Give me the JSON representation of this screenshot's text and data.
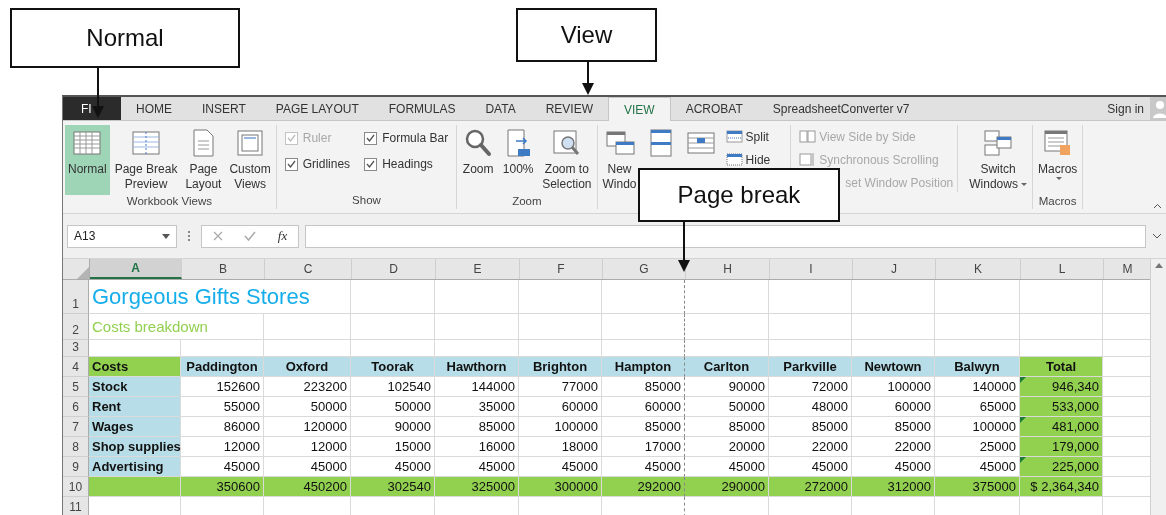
{
  "callouts": [
    {
      "text": "Normal"
    },
    {
      "text": "View"
    },
    {
      "text": "Page break"
    }
  ],
  "tabs": [
    {
      "label": "FI",
      "kind": "file",
      "selected": false
    },
    {
      "label": "HOME",
      "kind": "tab",
      "selected": false
    },
    {
      "label": "INSERT",
      "kind": "tab",
      "selected": false
    },
    {
      "label": "PAGE LAYOUT",
      "kind": "tab",
      "selected": false
    },
    {
      "label": "FORMULAS",
      "kind": "tab",
      "selected": false
    },
    {
      "label": "DATA",
      "kind": "tab",
      "selected": false
    },
    {
      "label": "REVIEW",
      "kind": "tab",
      "selected": false
    },
    {
      "label": "VIEW",
      "kind": "tab",
      "selected": true
    },
    {
      "label": "ACROBAT",
      "kind": "tab",
      "selected": false
    },
    {
      "label": "SpreadsheetConverter v7",
      "kind": "tab",
      "selected": false
    }
  ],
  "account": {
    "label": "Sign in"
  },
  "ribbon": {
    "groups": [
      {
        "label": "Workbook Views",
        "items": [
          {
            "kind": "large",
            "lines": [
              "Normal"
            ],
            "selected": true
          },
          {
            "kind": "large",
            "lines": [
              "Page Break",
              "Preview"
            ],
            "selected": false
          },
          {
            "kind": "large",
            "lines": [
              "Page",
              "Layout"
            ],
            "selected": false
          },
          {
            "kind": "large",
            "lines": [
              "Custom",
              "Views"
            ],
            "selected": false
          }
        ]
      },
      {
        "label": "Show",
        "items": [
          {
            "kind": "check",
            "label": "Ruler",
            "checked": true,
            "disabled": true
          },
          {
            "kind": "check",
            "label": "Gridlines",
            "checked": true,
            "disabled": false
          },
          {
            "kind": "check",
            "label": "Formula Bar",
            "checked": true,
            "disabled": false
          },
          {
            "kind": "check",
            "label": "Headings",
            "checked": true,
            "disabled": false
          }
        ]
      },
      {
        "label": "Zoom",
        "items": [
          {
            "kind": "large",
            "lines": [
              "Zoom"
            ]
          },
          {
            "kind": "large",
            "lines": [
              "100%"
            ]
          },
          {
            "kind": "large",
            "lines": [
              "Zoom to",
              "Selection"
            ]
          }
        ]
      },
      {
        "items": [
          {
            "kind": "large",
            "lines": [
              "New",
              "Windo"
            ]
          },
          {
            "kind": "large"
          },
          {
            "kind": "large"
          },
          {
            "kind": "small",
            "label": "Split",
            "disabled": false
          },
          {
            "kind": "small",
            "label": "Hide",
            "disabled": false
          },
          {
            "kind": "small",
            "label": "View Side by Side",
            "disabled": true
          },
          {
            "kind": "small",
            "label": "Synchronous Scrolling",
            "disabled": true
          },
          {
            "kind": "partial",
            "label": "set Window Position",
            "disabled": true
          },
          {
            "kind": "large",
            "lines": [
              "Switch",
              "Windows"
            ],
            "dropdown": true
          }
        ]
      },
      {
        "label": "Macros",
        "items": [
          {
            "kind": "large",
            "lines": [
              "Macros"
            ],
            "dropdown": true
          }
        ]
      }
    ]
  },
  "formula_bar": {
    "name_box": "A13",
    "function_label": "fx"
  },
  "columns": [
    {
      "letter": "A",
      "selected": true,
      "page_break": false
    },
    {
      "letter": "B",
      "selected": false,
      "page_break": false
    },
    {
      "letter": "C",
      "selected": false,
      "page_break": false
    },
    {
      "letter": "D",
      "selected": false,
      "page_break": false
    },
    {
      "letter": "E",
      "selected": false,
      "page_break": false
    },
    {
      "letter": "F",
      "selected": false,
      "page_break": false
    },
    {
      "letter": "G",
      "selected": false,
      "page_break": true
    },
    {
      "letter": "H",
      "selected": false,
      "page_break": false
    },
    {
      "letter": "I",
      "selected": false,
      "page_break": false
    },
    {
      "letter": "J",
      "selected": false,
      "page_break": false
    },
    {
      "letter": "K",
      "selected": false,
      "page_break": false
    },
    {
      "letter": "L",
      "selected": false,
      "page_break": false
    },
    {
      "letter": "M",
      "selected": false,
      "page_break": false
    }
  ],
  "rows": [
    {
      "number": "1",
      "kind": "title",
      "text": "Gorgeous Gifts Stores"
    },
    {
      "number": "2",
      "kind": "subtitle",
      "text": "Costs breakdown"
    },
    {
      "number": "3",
      "kind": "blank"
    },
    {
      "number": "4",
      "kind": "header",
      "label": "Costs",
      "values": [
        "Paddington",
        "Oxford",
        "Toorak",
        "Hawthorn",
        "Brighton",
        "Hampton",
        "Carlton",
        "Parkville",
        "Newtown",
        "Balwyn"
      ],
      "total": "Total"
    },
    {
      "number": "5",
      "kind": "data",
      "label": "Stock",
      "values": [
        "152600",
        "223200",
        "102540",
        "144000",
        "77000",
        "85000",
        "90000",
        "72000",
        "100000",
        "140000"
      ],
      "total": "946,340",
      "flagged": true
    },
    {
      "number": "6",
      "kind": "data",
      "label": "Rent",
      "values": [
        "55000",
        "50000",
        "50000",
        "35000",
        "60000",
        "60000",
        "50000",
        "48000",
        "60000",
        "65000"
      ],
      "total": "533,000",
      "flagged": false
    },
    {
      "number": "7",
      "kind": "data",
      "label": "Wages",
      "values": [
        "86000",
        "120000",
        "90000",
        "85000",
        "100000",
        "85000",
        "85000",
        "85000",
        "85000",
        "100000"
      ],
      "total": "481,000",
      "flagged": true
    },
    {
      "number": "8",
      "kind": "data",
      "label": "Shop supplies",
      "values": [
        "12000",
        "12000",
        "15000",
        "16000",
        "18000",
        "17000",
        "20000",
        "22000",
        "22000",
        "25000"
      ],
      "total": "179,000",
      "flagged": false
    },
    {
      "number": "9",
      "kind": "data",
      "label": "Advertising",
      "values": [
        "45000",
        "45000",
        "45000",
        "45000",
        "45000",
        "45000",
        "45000",
        "45000",
        "45000",
        "45000"
      ],
      "total": "225,000",
      "flagged": true
    },
    {
      "number": "10",
      "kind": "sum",
      "values": [
        "350600",
        "450200",
        "302540",
        "325000",
        "300000",
        "292000",
        "290000",
        "272000",
        "312000",
        "375000"
      ],
      "total": "$ 2,364,340"
    },
    {
      "number": "11",
      "kind": "blank"
    }
  ]
}
